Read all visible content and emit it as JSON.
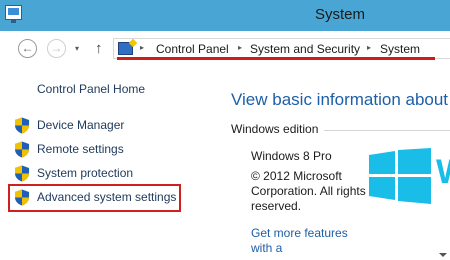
{
  "window": {
    "title": "System"
  },
  "nav": {
    "back_glyph": "←",
    "forward_glyph": "→",
    "recent_glyph": "▾",
    "up_glyph": "↑"
  },
  "address": {
    "separator": "▸",
    "crumbs": [
      "Control Panel",
      "System and Security",
      "System"
    ]
  },
  "left_pane": {
    "home_label": "Control Panel Home",
    "tasks": [
      {
        "label": "Device Manager",
        "icon": "shield-icon"
      },
      {
        "label": "Remote settings",
        "icon": "shield-icon"
      },
      {
        "label": "System protection",
        "icon": "shield-icon"
      },
      {
        "label": "Advanced system settings",
        "icon": "shield-icon"
      }
    ]
  },
  "main": {
    "heading": "View basic information about yo",
    "section_label": "Windows edition",
    "edition": "Windows 8 Pro",
    "copyright": "© 2012 Microsoft Corporation. All rights reserved.",
    "more_features": "Get more features with a"
  },
  "colors": {
    "titlebar": "#49a6d4",
    "link": "#1e395b",
    "heading": "#1d5fa8",
    "windows_logo": "#19bde8",
    "annotation_red": "#cc1c1c"
  }
}
